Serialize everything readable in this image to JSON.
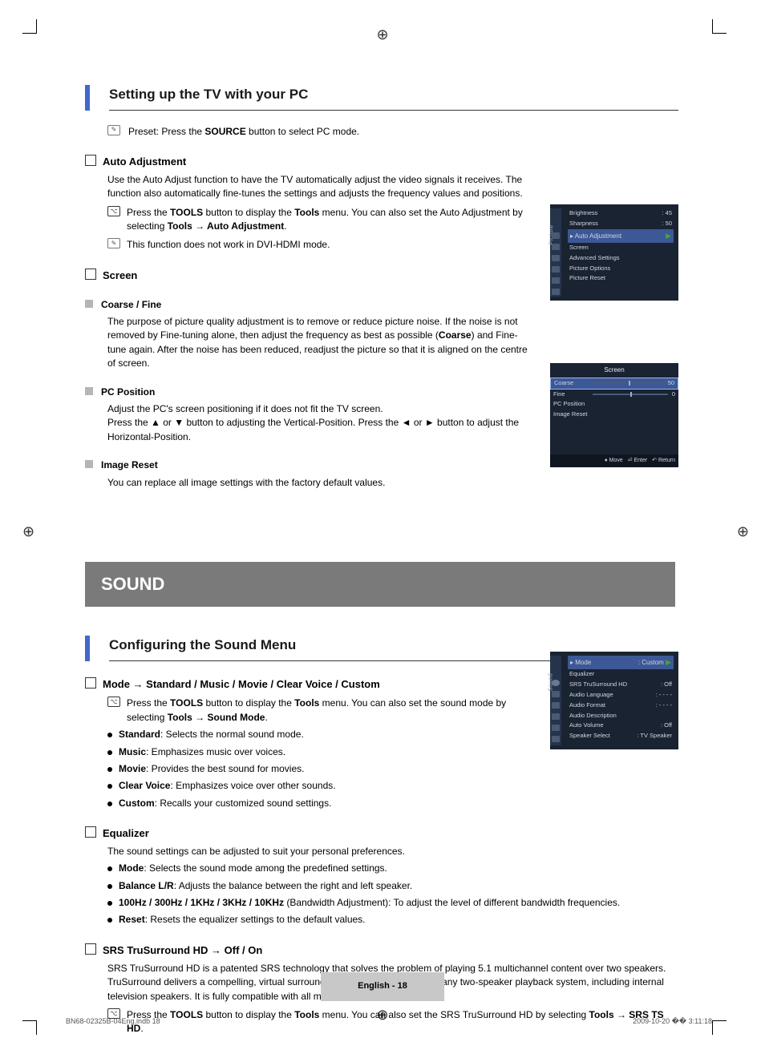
{
  "section1": {
    "title": "Setting up the TV with your PC",
    "preset_line_pre": "Preset: Press the ",
    "preset_bold": "SOURCE",
    "preset_line_post": " button to select PC mode.",
    "auto_adj_title": "Auto Adjustment",
    "auto_adj_body": "Use the Auto Adjust function to have the TV automatically adjust the video signals it receives. The function also automatically fine-tunes the settings and adjusts the frequency values and positions.",
    "auto_adj_tool_pre": "Press the ",
    "auto_adj_tool_b1": "TOOLS",
    "auto_adj_tool_mid": " button to display the ",
    "auto_adj_tool_b2": "Tools",
    "auto_adj_tool_post": " menu. You can also set the Auto Adjustment by selecting ",
    "auto_adj_tool_b3": "Tools → Auto Adjustment",
    "auto_adj_tool_end": ".",
    "auto_adj_note": "This function does not work in DVI-HDMI mode.",
    "screen_title": "Screen",
    "coarse_title": "Coarse / Fine",
    "coarse_body_pre": "The purpose of picture quality adjustment is to remove or reduce picture noise. If the noise is not removed by Fine-tuning alone, then adjust the frequency as best as possible (",
    "coarse_bold": "Coarse",
    "coarse_body_post": ") and Fine-tune again. After the noise has been reduced, readjust the picture so that it is aligned on the centre of screen.",
    "pc_pos_title": "PC Position",
    "pc_pos_body": "Adjust the PC's screen positioning if it does not fit the TV screen.\nPress the ▲ or ▼ button to adjusting the Vertical-Position. Press the ◄ or ► button to adjust the Horizontal-Position.",
    "img_reset_title": "Image Reset",
    "img_reset_body": "You can replace all image settings with the factory default values."
  },
  "banner": "SOUND",
  "section2": {
    "title": "Configuring the Sound Menu",
    "mode_title": "Mode → Standard / Music / Movie / Clear Voice / Custom",
    "mode_tool_pre": "Press the ",
    "mode_tool_b1": "TOOLS",
    "mode_tool_mid": " button to display the ",
    "mode_tool_b2": "Tools",
    "mode_tool_post": " menu. You can also set the sound mode by selecting ",
    "mode_tool_b3": "Tools → Sound Mode",
    "mode_tool_end": ".",
    "mode_items": [
      {
        "b": "Standard",
        "t": ": Selects the normal sound mode."
      },
      {
        "b": "Music",
        "t": ": Emphasizes music over voices."
      },
      {
        "b": "Movie",
        "t": ": Provides the best sound for movies."
      },
      {
        "b": "Clear Voice",
        "t": ": Emphasizes voice over other sounds."
      },
      {
        "b": "Custom",
        "t": ": Recalls your customized sound settings."
      }
    ],
    "eq_title": "Equalizer",
    "eq_body": "The sound settings can be adjusted to suit your personal preferences.",
    "eq_items": [
      {
        "b": "Mode",
        "t": ": Selects the sound mode among the predefined settings."
      },
      {
        "b": "Balance L/R",
        "t": ": Adjusts the balance between the right and left speaker."
      },
      {
        "b": "100Hz / 300Hz / 1KHz / 3KHz / 10KHz",
        "t": " (Bandwidth Adjustment): To adjust the level of different bandwidth frequencies."
      },
      {
        "b": "Reset",
        "t": ": Resets the equalizer settings to the default values."
      }
    ],
    "srs_title": "SRS TruSurround HD → Off / On",
    "srs_body": "SRS TruSurround HD is a patented SRS technology that solves the problem of playing 5.1 multichannel content over two speakers. TruSurround delivers a compelling, virtual surround sound experience through any two-speaker playback system, including internal television speakers. It is fully compatible with all multichannel formats.",
    "srs_tool_pre": "Press the ",
    "srs_tool_b1": "TOOLS",
    "srs_tool_mid": " button to display the ",
    "srs_tool_b2": "Tools",
    "srs_tool_post": " menu. You can also set the SRS TruSurround HD by selecting ",
    "srs_tool_b3": "Tools → SRS TS HD",
    "srs_tool_end": "."
  },
  "osd1": {
    "side": "Picture",
    "rows": [
      [
        "Brightness",
        ": 45"
      ],
      [
        "Sharpness",
        ": 50"
      ]
    ],
    "hl": "Auto Adjustment",
    "items": [
      "Screen",
      "Advanced Settings",
      "Picture Options",
      "Picture Reset"
    ]
  },
  "osd2": {
    "title": "Screen",
    "r1": [
      "Coarse",
      "50"
    ],
    "r2": [
      "Fine",
      "0"
    ],
    "items": [
      "PC Position",
      "Image Reset"
    ],
    "bottom": [
      "Move",
      "Enter",
      "Return"
    ]
  },
  "osd3": {
    "side": "Sound",
    "hl": [
      "Mode",
      ": Custom"
    ],
    "rows": [
      [
        "Equalizer",
        ""
      ],
      [
        "SRS TruSurround HD",
        ": Off"
      ],
      [
        "Audio Language",
        ": - - - -"
      ],
      [
        "Audio Format",
        ": - - - -"
      ],
      [
        "Audio Description",
        ""
      ],
      [
        "Auto Volume",
        ": Off"
      ],
      [
        "Speaker Select",
        ": TV Speaker"
      ]
    ]
  },
  "footer": "English - 18",
  "meta_left": "BN68-02325B-04Eng.indb   18",
  "meta_right": "2009-10-20   �� 3:11:18"
}
